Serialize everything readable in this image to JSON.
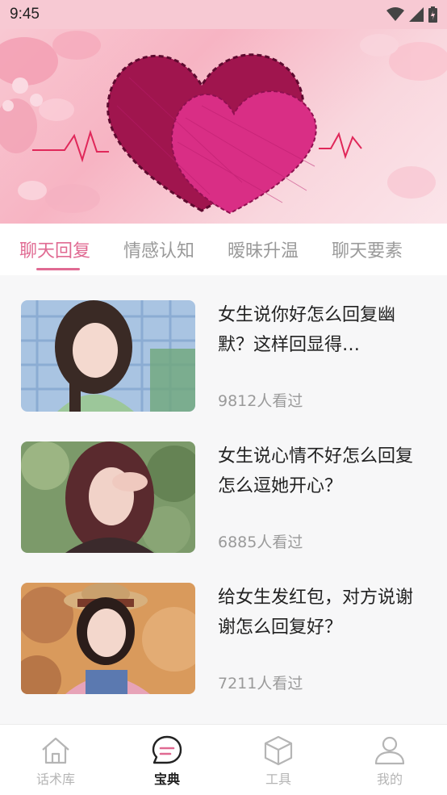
{
  "status_bar": {
    "time": "9:45"
  },
  "tabs": [
    {
      "label": "聊天回复",
      "active": true
    },
    {
      "label": "情感认知",
      "active": false
    },
    {
      "label": "暧昧升温",
      "active": false
    },
    {
      "label": "聊天要素",
      "active": false
    }
  ],
  "articles": [
    {
      "title": "女生说你好怎么回复幽默？这样回显得…",
      "views": "9812人看过"
    },
    {
      "title": "女生说心情不好怎么回复怎么逗她开心？",
      "views": "6885人看过"
    },
    {
      "title": "给女生发红包，对方说谢谢怎么回复好？",
      "views": "7211人看过"
    }
  ],
  "bottom_nav": [
    {
      "label": "话术库",
      "icon": "home-icon",
      "active": false
    },
    {
      "label": "宝典",
      "icon": "chat-bubble-icon",
      "active": true
    },
    {
      "label": "工具",
      "icon": "cube-icon",
      "active": false
    },
    {
      "label": "我的",
      "icon": "user-icon",
      "active": false
    }
  ],
  "colors": {
    "accent": "#e06a92",
    "status_bar": "#f7c9d3",
    "inactive": "#9a9a9a"
  }
}
